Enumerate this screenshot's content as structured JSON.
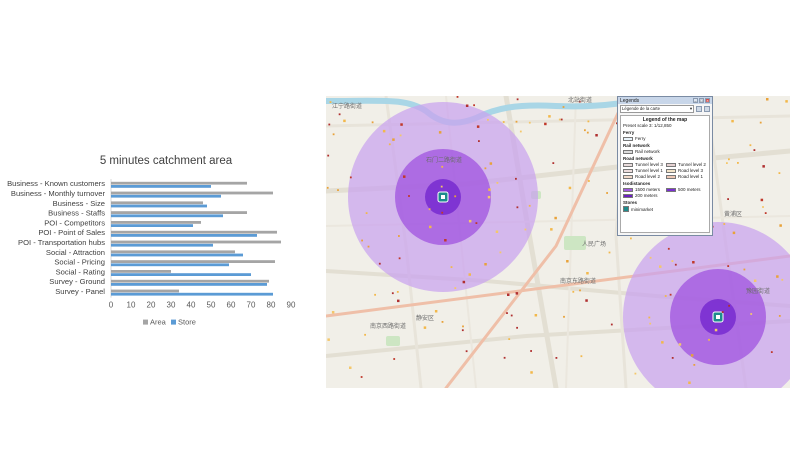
{
  "chart_data": {
    "type": "bar",
    "orientation": "horizontal",
    "title": "5 minutes catchment area",
    "categories": [
      "Business - Known customers",
      "Business - Monthly turnover",
      "Business - Size",
      "Business - Staffs",
      "POI - Competitors",
      "POI - Point of Sales",
      "POI - Transportation hubs",
      "Social - Attraction",
      "Social - Pricing",
      "Social - Rating",
      "Survey - Ground",
      "Survey - Panel"
    ],
    "series": [
      {
        "name": "Area",
        "color": "#a5a5a5",
        "values": [
          68,
          81,
          46,
          68,
          45,
          83,
          85,
          62,
          82,
          30,
          79,
          34
        ]
      },
      {
        "name": "Store",
        "color": "#5b9bd5",
        "values": [
          50,
          55,
          48,
          56,
          41,
          73,
          51,
          66,
          59,
          70,
          78,
          81
        ]
      }
    ],
    "xlim": [
      0,
      90
    ],
    "xticks": [
      "0",
      "10",
      "20",
      "30",
      "40",
      "50",
      "60",
      "70",
      "80",
      "90"
    ],
    "legend_position": "bottom",
    "grid": false
  },
  "map": {
    "labels": [
      {
        "text": "江宁路街道"
      },
      {
        "text": "北站街道"
      },
      {
        "text": "石门二路街道"
      },
      {
        "text": "南京东路街道"
      },
      {
        "text": "人民广场"
      },
      {
        "text": "静安区"
      },
      {
        "text": "南京西路街道"
      },
      {
        "text": "黄浦区"
      },
      {
        "text": "豫园街道"
      }
    ],
    "colors": {
      "outer_ring": "#c9a2ee",
      "middle_ring": "#a259e0",
      "inner_ring": "#7a2fd0",
      "background": "#f1efe8"
    },
    "store_icon": "store-marker-icon"
  },
  "legend_window": {
    "title": "Legends",
    "select_value": "Légende de la carte",
    "heading": "Legend of the map",
    "preset_scale": "Preset scale 3: 1/12,850",
    "sections": {
      "ferry": {
        "title": "Ferry",
        "items": [
          "Ferry"
        ]
      },
      "rail": {
        "title": "Rail network",
        "items": [
          "Rail network"
        ]
      },
      "road": {
        "title": "Road network",
        "items": [
          "Tunnel level 3",
          "Tunnel level 2",
          "Tunnel level 1",
          "Road level 3",
          "Road level 2",
          "Road level 1"
        ]
      },
      "isodistances": {
        "title": "Isodistances",
        "items": [
          "1500 meters",
          "500 meters",
          "200 meters"
        ]
      },
      "stores": {
        "title": "Stores",
        "items": [
          "minimarket"
        ]
      }
    }
  }
}
